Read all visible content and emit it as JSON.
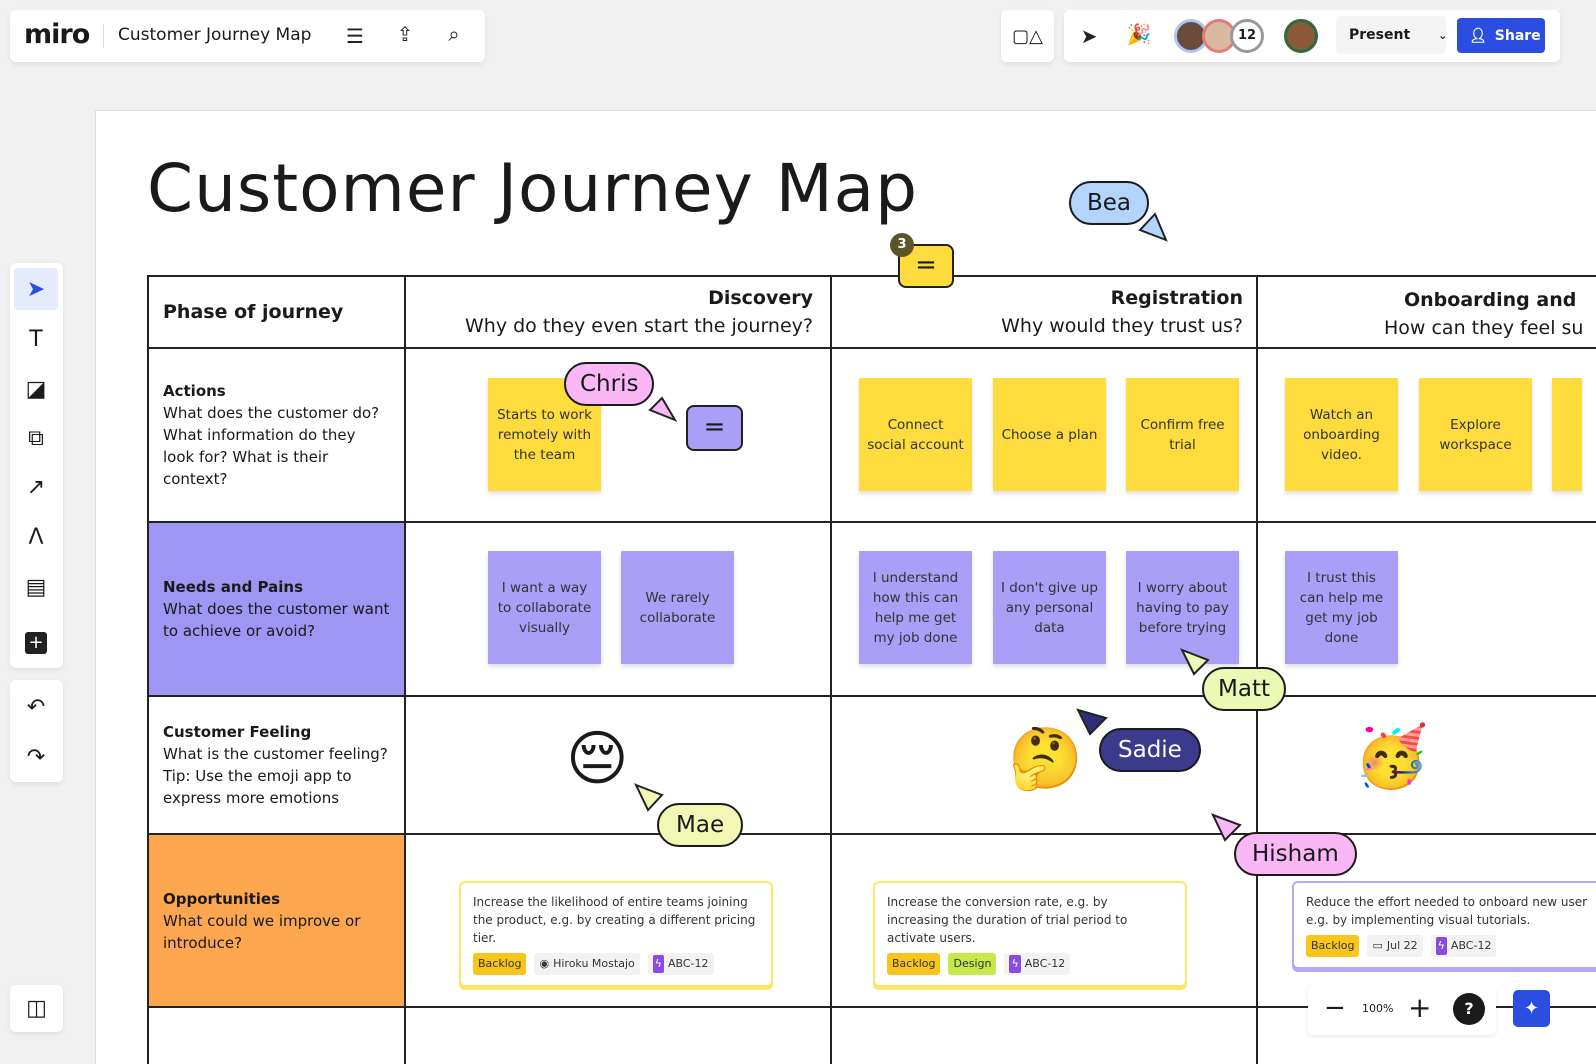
{
  "app": {
    "logo": "miro",
    "board_title": "Customer Journey Map"
  },
  "toolbar": {
    "present_label": "Present",
    "share_label": "Share",
    "collaborator_count": "12"
  },
  "board": {
    "title": "Customer Journey Map"
  },
  "table": {
    "header_label": "Phase of journey",
    "phases": [
      {
        "name": "Discovery",
        "question": "Why do they even start the journey?"
      },
      {
        "name": "Registration",
        "question": "Why would they trust us?"
      },
      {
        "name": "Onboarding and",
        "question": "How can they feel su"
      }
    ],
    "rows": [
      {
        "title": "Actions",
        "desc": "What does the customer do? What information do they look for? What is their context?"
      },
      {
        "title": "Needs and Pains",
        "desc": "What does the customer want to achieve or avoid?",
        "color": "#9f95f3"
      },
      {
        "title": "Customer Feeling",
        "desc": "What is the customer feeling? Tip: Use the emoji app to express more emotions"
      },
      {
        "title": "Opportunities",
        "desc": "What could we improve or introduce?",
        "color": "#fca650"
      }
    ]
  },
  "stickies": {
    "actions": [
      "Starts to work remotely with the team",
      "Connect social account",
      "Choose a plan",
      "Confirm free trial",
      "Watch an onboarding video.",
      "Explore workspace"
    ],
    "needs": [
      "I want a way to collaborate visually",
      "We rarely collaborate",
      "I understand how this can help me get my job done",
      "I don't give up any personal data",
      "I worry about having to pay before trying",
      "I trust this can help me get my job done"
    ]
  },
  "feelings": [
    "😔",
    "🤔",
    "🥳"
  ],
  "opportunities": [
    {
      "text": "Increase the likelihood of entire teams joining the product, e.g. by creating a different pricing tier.",
      "tags": [
        "Backlog",
        "Hiroku Mostajo",
        "ABC-12"
      ]
    },
    {
      "text": "Increase the conversion rate, e.g. by increasing the duration of trial period to activate users.",
      "tags": [
        "Backlog",
        "Design",
        "ABC-12"
      ]
    },
    {
      "text": "Reduce the effort needed to onboard new user e.g. by implementing visual tutorials.",
      "tags": [
        "Backlog",
        "Jul 22",
        "ABC-12"
      ]
    }
  ],
  "cursors": {
    "chris": "Chris",
    "bea": "Bea",
    "matt": "Matt",
    "sadie": "Sadie",
    "mae": "Mae",
    "hisham": "Hisham"
  },
  "comments": {
    "count": "3"
  },
  "zoom": {
    "level": "100%",
    "help": "?"
  }
}
